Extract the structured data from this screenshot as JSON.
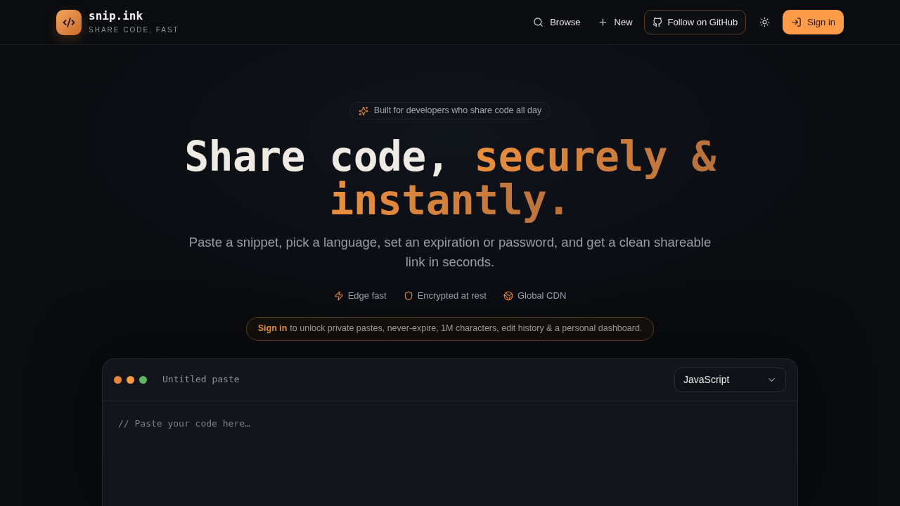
{
  "brand": {
    "name": "snip.ink",
    "tagline": "SHARE CODE, FAST"
  },
  "nav": {
    "links": [
      {
        "label": "Browse"
      },
      {
        "label": "New"
      }
    ],
    "github_button": "Follow on GitHub",
    "sign_in_button": "Sign in"
  },
  "hero": {
    "badge": "Built for developers who share code all day",
    "title_start": "Share code,",
    "title_highlight": "securely & instantly.",
    "subtitle": "Paste a snippet, pick a language, set an expiration or password, and get a clean shareable link in seconds.",
    "features": [
      {
        "label": "Edge fast"
      },
      {
        "label": "Encrypted at rest"
      },
      {
        "label": "Global CDN"
      }
    ],
    "notice": {
      "link": "Sign in",
      "text": "to unlock private pastes, never-expire, 1M characters, edit history & a personal dashboard."
    }
  },
  "editor": {
    "window_dots": [
      {
        "color": "#e5843c"
      },
      {
        "color": "#f59b45"
      },
      {
        "color": "#5cb85c"
      }
    ],
    "title": "Untitled paste",
    "language": "JavaScript",
    "placeholder": "// Paste your code here…"
  }
}
